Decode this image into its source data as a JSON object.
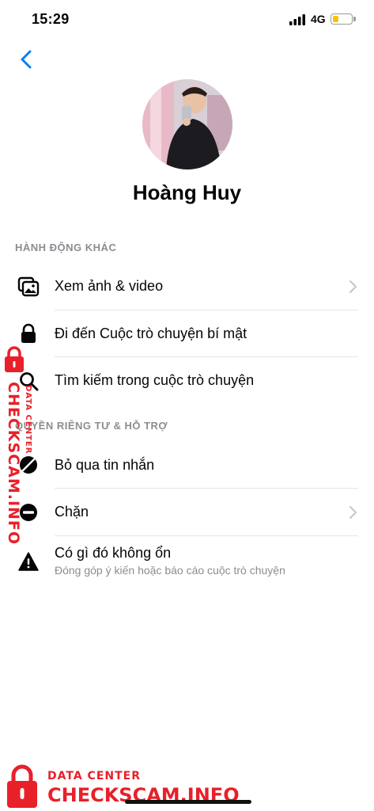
{
  "status_bar": {
    "time": "15:29",
    "network": "4G",
    "battery_level": 0.3
  },
  "profile": {
    "name": "Hoàng Huy"
  },
  "sections": [
    {
      "title": "HÀNH ĐỘNG KHÁC"
    },
    {
      "title": "QUYỀN RIÊNG TƯ & HỖ TRỢ"
    }
  ],
  "actions": [
    {
      "label": "Xem ảnh & video",
      "icon": "photos-icon"
    },
    {
      "label": "Đi đến Cuộc trò chuyện bí mật",
      "icon": "lock-icon"
    },
    {
      "label": "Tìm kiếm trong cuộc trò chuyện",
      "icon": "search-icon"
    }
  ],
  "privacy": [
    {
      "label": "Bỏ qua tin nhắn",
      "icon": "ignore-icon"
    },
    {
      "label": "Chặn",
      "icon": "block-icon"
    },
    {
      "label": "Có gì đó không ổn",
      "sub": "Đóng góp ý kiến hoặc báo cáo cuộc trò chuyện",
      "icon": "warning-icon"
    }
  ],
  "watermark": {
    "line1": "DATA CENTER",
    "line2": "CHECKSCAM.INFO",
    "side_small": "DATA CENTER",
    "side_big": "CHECKSCAM.INFO"
  },
  "colors": {
    "accent": "#0a7cff",
    "watermark": "#e8202a",
    "secondary_text": "#8a8d91"
  }
}
